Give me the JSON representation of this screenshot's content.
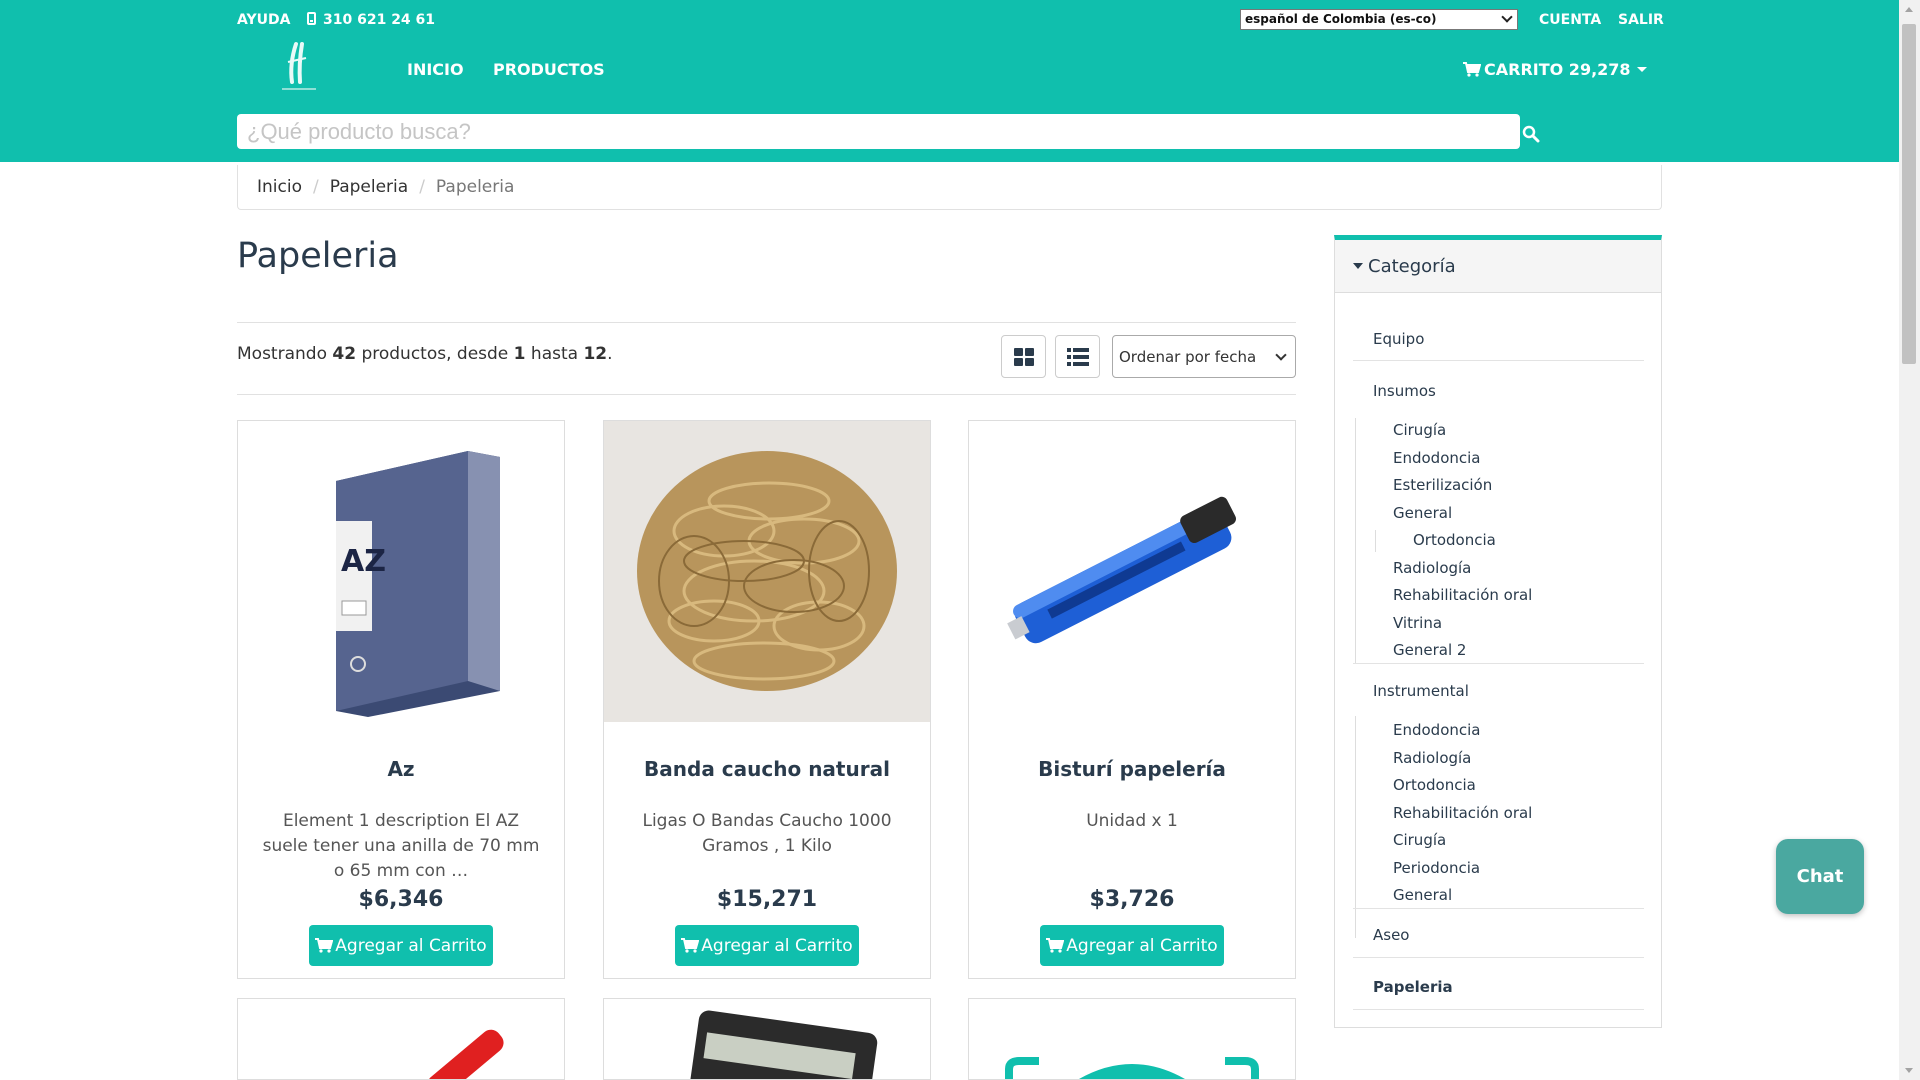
{
  "header": {
    "help": "AYUDA",
    "phone": "310 621 24 61",
    "language": "español de Colombia (es-co)",
    "account": "CUENTA",
    "logout": "SALIR",
    "nav": [
      "INICIO",
      "PRODUCTOS"
    ],
    "cart": "CARRITO 29,278",
    "search_placeholder": "¿Qué producto busca?",
    "accent": "#10bfad"
  },
  "breadcrumb": [
    "Inicio",
    "Papeleria",
    "Papeleria"
  ],
  "main": {
    "title": "Papeleria",
    "showing_prefix": "Mostrando",
    "total": "42",
    "showing_mid": "productos, desde",
    "from": "1",
    "showing_to": "hasta",
    "to": "12",
    "showing_end": ".",
    "sort": "Ordenar por fecha",
    "view_icons": [
      "grid-view-icon",
      "list-view-icon"
    ]
  },
  "products": [
    {
      "name": "Az",
      "description": "Element 1 description El AZ suele tener una anilla de 70 mm o 65 mm con …",
      "price": "$6,346",
      "button": "Agregar al Carrito"
    },
    {
      "name": "Banda caucho natural",
      "description": "Ligas O Bandas Caucho 1000 Gramos , 1 Kilo",
      "price": "$15,271",
      "button": "Agregar al Carrito"
    },
    {
      "name": "Bisturí papelería",
      "description": "Unidad x 1",
      "price": "$3,726",
      "button": "Agregar al Carrito"
    }
  ],
  "sidebar": {
    "heading": "Categoría",
    "equipo": "Equipo",
    "insumos": "Insumos",
    "insumos_sub": [
      "Cirugía",
      "Endodoncia",
      "Esterilización",
      "General",
      "Ortodoncia",
      "Radiología",
      "Rehabilitación oral",
      "Vitrina",
      "General 2"
    ],
    "instrumental": "Instrumental",
    "instrumental_sub": [
      "Endodoncia",
      "Radiología",
      "Ortodoncia",
      "Rehabilitación oral",
      "Cirugía",
      "Periodoncia",
      "General"
    ],
    "aseo": "Aseo",
    "papeleria": "Papeleria"
  },
  "chat": "Chat"
}
